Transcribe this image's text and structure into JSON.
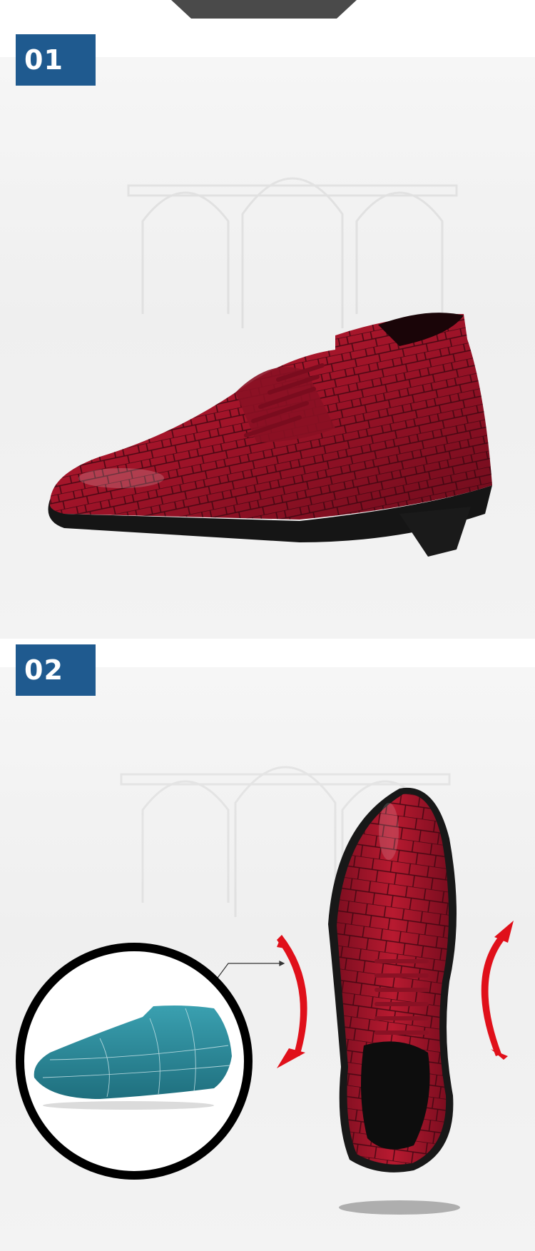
{
  "sections": [
    {
      "number": "01",
      "image": "red-croc-oxford-side-view"
    },
    {
      "number": "02",
      "image": "red-croc-oxford-top-view-with-shoe-last"
    }
  ],
  "colors": {
    "badge": "#1f5a8f",
    "shoe": "#a0152a",
    "arrow": "#e0101a",
    "last": "#2e8a9a"
  }
}
